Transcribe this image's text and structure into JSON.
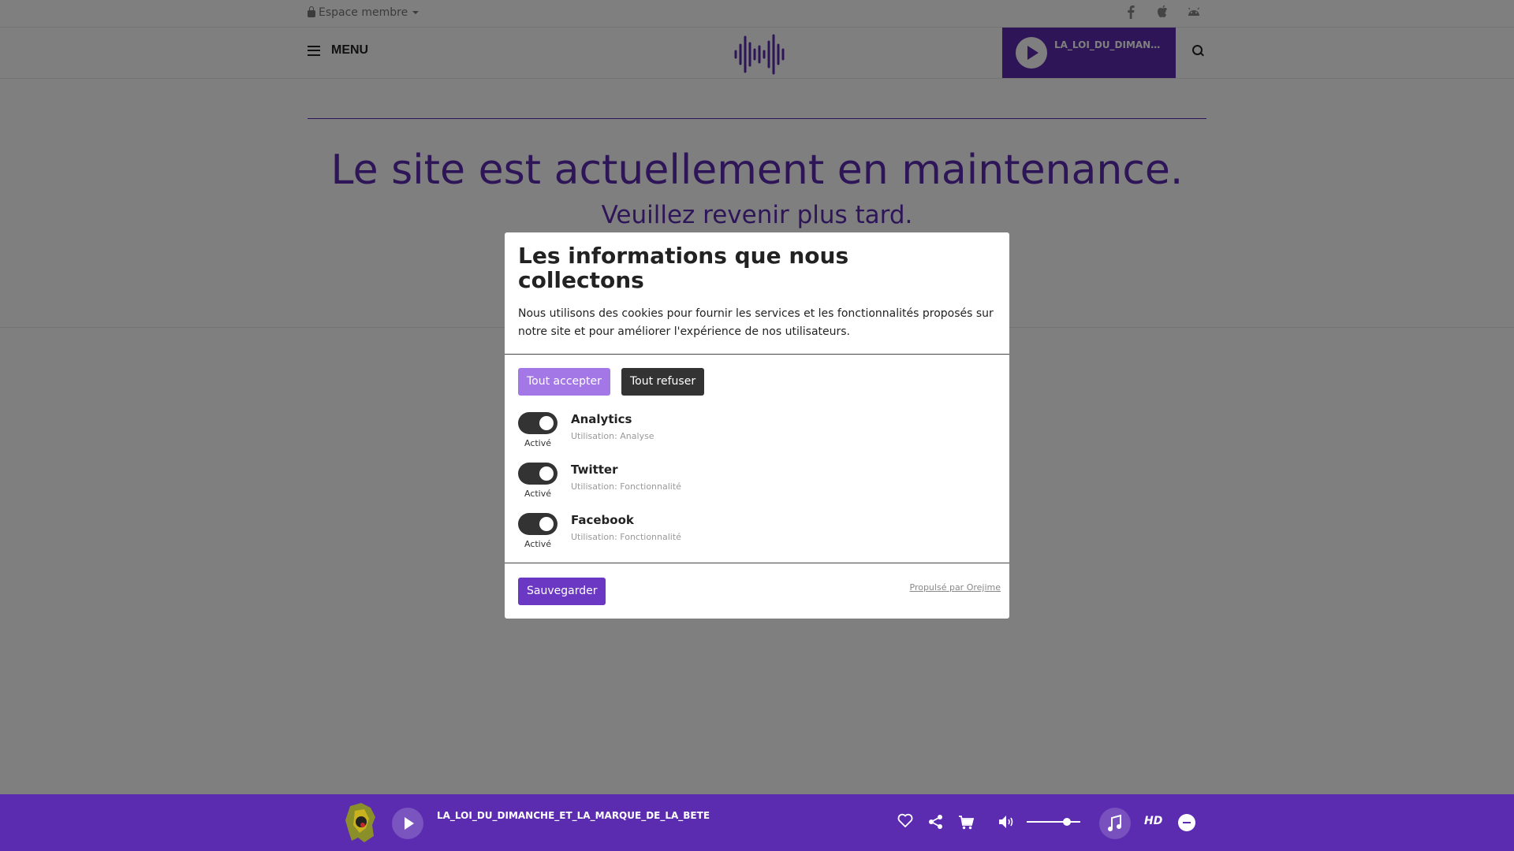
{
  "topbar": {
    "member_label": "Espace membre",
    "social_icons": [
      "facebook-icon",
      "apple-icon",
      "android-icon"
    ]
  },
  "header": {
    "menu_label": "MENU",
    "live_title": "LA_LOI_DU_DIMANCH..."
  },
  "content": {
    "maintenance_title": "Le site est actuellement en maintenance.",
    "maintenance_subtitle": "Veuillez revenir plus tard."
  },
  "modal": {
    "title": "Les informations que nous collectons",
    "description": "Nous utilisons des cookies pour fournir les services et les fonctionnalités proposés sur notre site et pour améliorer l'expérience de nos utilisateurs.",
    "accept_label": "Tout accepter",
    "refuse_label": "Tout refuser",
    "purposes": [
      {
        "name": "Analytics",
        "usage": "Utilisation: Analyse",
        "state": "Activé"
      },
      {
        "name": "Twitter",
        "usage": "Utilisation: Fonctionnalité",
        "state": "Activé"
      },
      {
        "name": "Facebook",
        "usage": "Utilisation: Fonctionnalité",
        "state": "Activé"
      }
    ],
    "save_label": "Sauvegarder",
    "powered_by": "Propulsé par Orejime"
  },
  "player": {
    "title": "LA_LOI_DU_DIMANCHE_ET_LA_MARQUE_DE_LA_BETE",
    "hd_label": "HD",
    "volume_level": 0.75
  },
  "colors": {
    "brand": "#5b2bb0",
    "accept_button": "#a477e6",
    "refuse_button": "#333333",
    "save_button": "#6b38c4"
  }
}
